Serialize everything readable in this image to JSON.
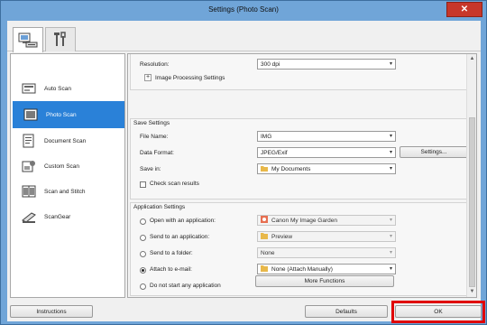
{
  "window": {
    "title": "Settings (Photo Scan)"
  },
  "tabs": [
    {
      "name": "scan-tab",
      "icon": "scanner-computer-icon",
      "active": true
    },
    {
      "name": "general-settings-tab",
      "icon": "tools-icon",
      "active": false
    }
  ],
  "nav": {
    "items": [
      {
        "label": "Auto Scan",
        "icon": "auto-scan-icon"
      },
      {
        "label": "Photo Scan",
        "icon": "photo-scan-icon",
        "active": true
      },
      {
        "label": "Document Scan",
        "icon": "document-scan-icon"
      },
      {
        "label": "Custom Scan",
        "icon": "custom-scan-icon"
      },
      {
        "label": "Scan and Stitch",
        "icon": "scan-and-stitch-icon"
      },
      {
        "label": "ScanGear",
        "icon": "scangear-icon"
      }
    ]
  },
  "scan_options": {
    "resolution_label": "Resolution:",
    "resolution_value": "300 dpi",
    "image_processing_label": "Image Processing Settings"
  },
  "save_settings": {
    "title": "Save Settings",
    "file_name_label": "File Name:",
    "file_name_value": "IMG",
    "data_format_label": "Data Format:",
    "data_format_value": "JPEG/Exif",
    "settings_button": "Settings...",
    "save_in_label": "Save in:",
    "save_in_value": "My Documents",
    "check_scan_results_label": "Check scan results"
  },
  "app_settings": {
    "title": "Application Settings",
    "open_with_label": "Open with an application:",
    "open_with_value": "Canon My Image Garden",
    "send_to_app_label": "Send to an application:",
    "send_to_app_value": "Preview",
    "send_to_folder_label": "Send to a folder:",
    "send_to_folder_value": "None",
    "attach_email_label": "Attach to e-mail:",
    "attach_email_value": "None (Attach Manually)",
    "do_not_start_label": "Do not start any application",
    "more_functions_button": "More Functions",
    "selected": "attach_email"
  },
  "footer": {
    "instructions_button": "Instructions",
    "defaults_button": "Defaults",
    "ok_button": "OK"
  },
  "colors": {
    "accent": "#2a81d8",
    "highlight": "#e00000",
    "titlebar": "#70a5d8",
    "close": "#c7372a"
  }
}
